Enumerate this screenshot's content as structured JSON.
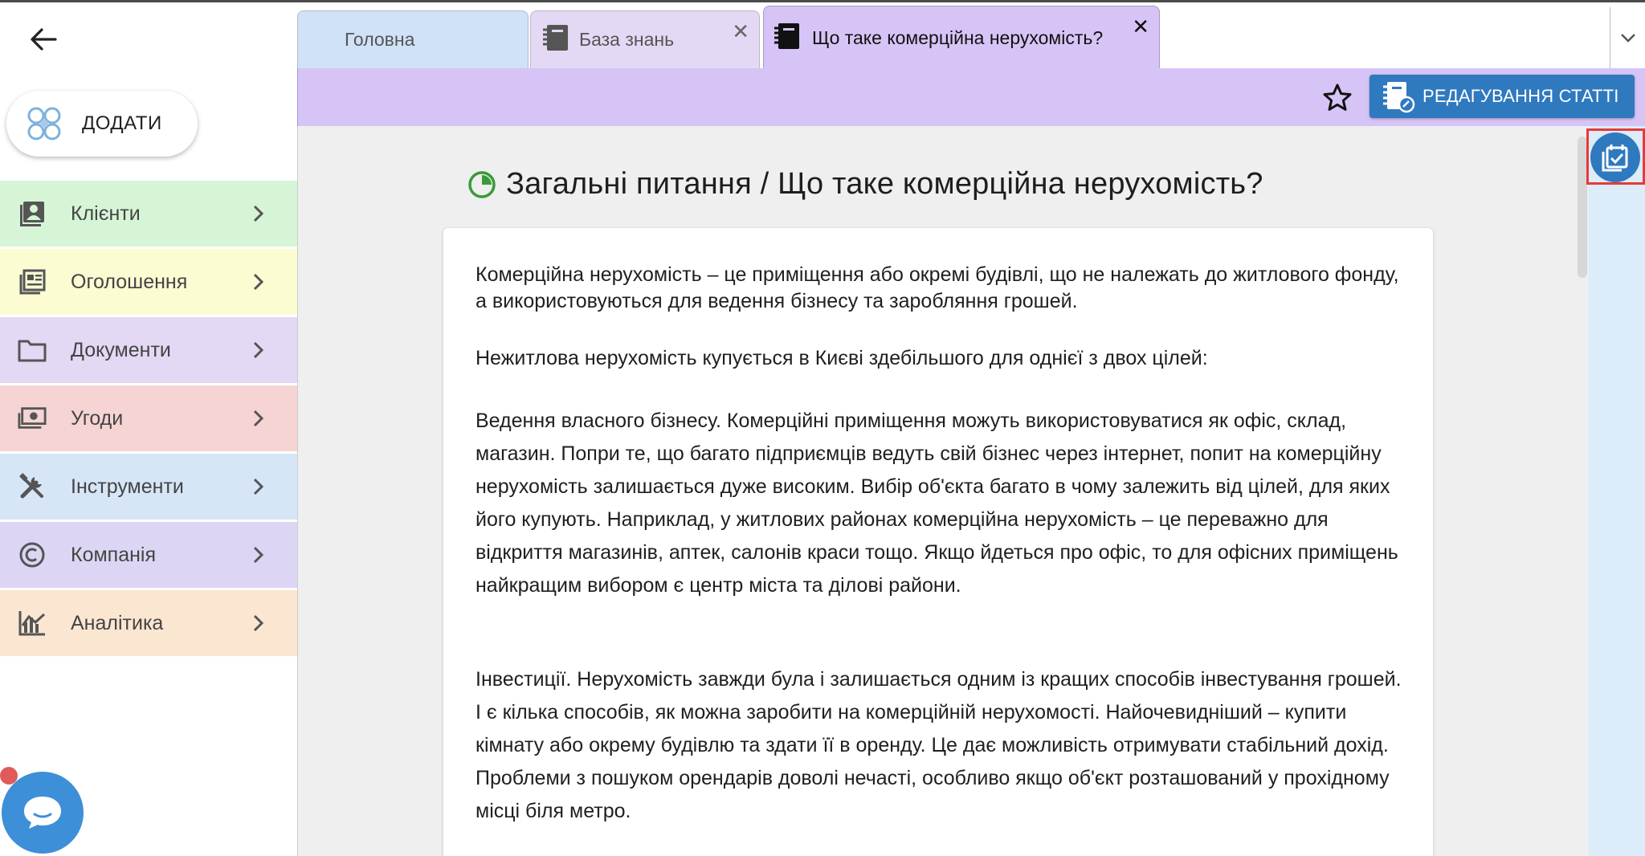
{
  "sidebar": {
    "add_label": "ДОДАТИ",
    "items": [
      {
        "label": "Клієнти",
        "icon": "contacts-icon",
        "bg": "#d6f5d6"
      },
      {
        "label": "Оголошення",
        "icon": "listing-icon",
        "bg": "#fbfcd2"
      },
      {
        "label": "Документи",
        "icon": "folder-icon",
        "bg": "#e3d9f4"
      },
      {
        "label": "Угоди",
        "icon": "money-icon",
        "bg": "#f6d4d4"
      },
      {
        "label": "Інструменти",
        "icon": "tools-icon",
        "bg": "#d6e6f7"
      },
      {
        "label": "Компанія",
        "icon": "copyright-icon",
        "bg": "#dcd6f4"
      },
      {
        "label": "Аналітика",
        "icon": "analytics-icon",
        "bg": "#fbe6d2"
      }
    ]
  },
  "tabs": {
    "home_label": "Головна",
    "kb_label": "База знань",
    "active_label": "Що таке комерційна нерухомість?",
    "close_glyph": "✕"
  },
  "header": {
    "edit_label": "РЕДАГУВАННЯ СТАТТІ"
  },
  "article": {
    "title": "Загальні питання / Що таке комерційна нерухомість?",
    "paragraphs": [
      "Комерційна нерухомість – це приміщення або окремі будівлі, що не належать до житлового фонду, а використовуються для ведення бізнесу та заробляння грошей.",
      "Нежитлова нерухомість купується в Києві здебільшого для однієї з двох цілей:",
      "Ведення власного бізнесу. Комерційні приміщення можуть використовуватися як офіс, склад, магазин. Попри те, що багато підприємців ведуть свій бізнес через інтернет, попит на комерційну нерухомість залишається дуже високим. Вибір об'єкта багато в чому залежить від цілей, для яких його купують. Наприклад, у житлових районах комерційна нерухомість – це переважно для відкриття магазинів, аптек, салонів краси тощо. Якщо йдеться про офіс, то для офісних приміщень найкращим вибором є центр міста та ділові райони.",
      "Інвестиції. Нерухомість завжди була і залишається одним із кращих способів інвестування грошей. І є кілька способів, як можна заробити на комерційній нерухомості. Найочевидніший – купити кімнату або окрему будівлю та здати її в оренду. Це дає можливість отримувати стабільний дохід. Проблеми з пошуком орендарів доволі нечасті, особливо якщо об'єкт розташований у прохідному місці біля метро."
    ]
  },
  "colors": {
    "accent": "#2f79bf",
    "tab_active": "#d6c4f6",
    "title_icon": "#3a9a3a"
  }
}
